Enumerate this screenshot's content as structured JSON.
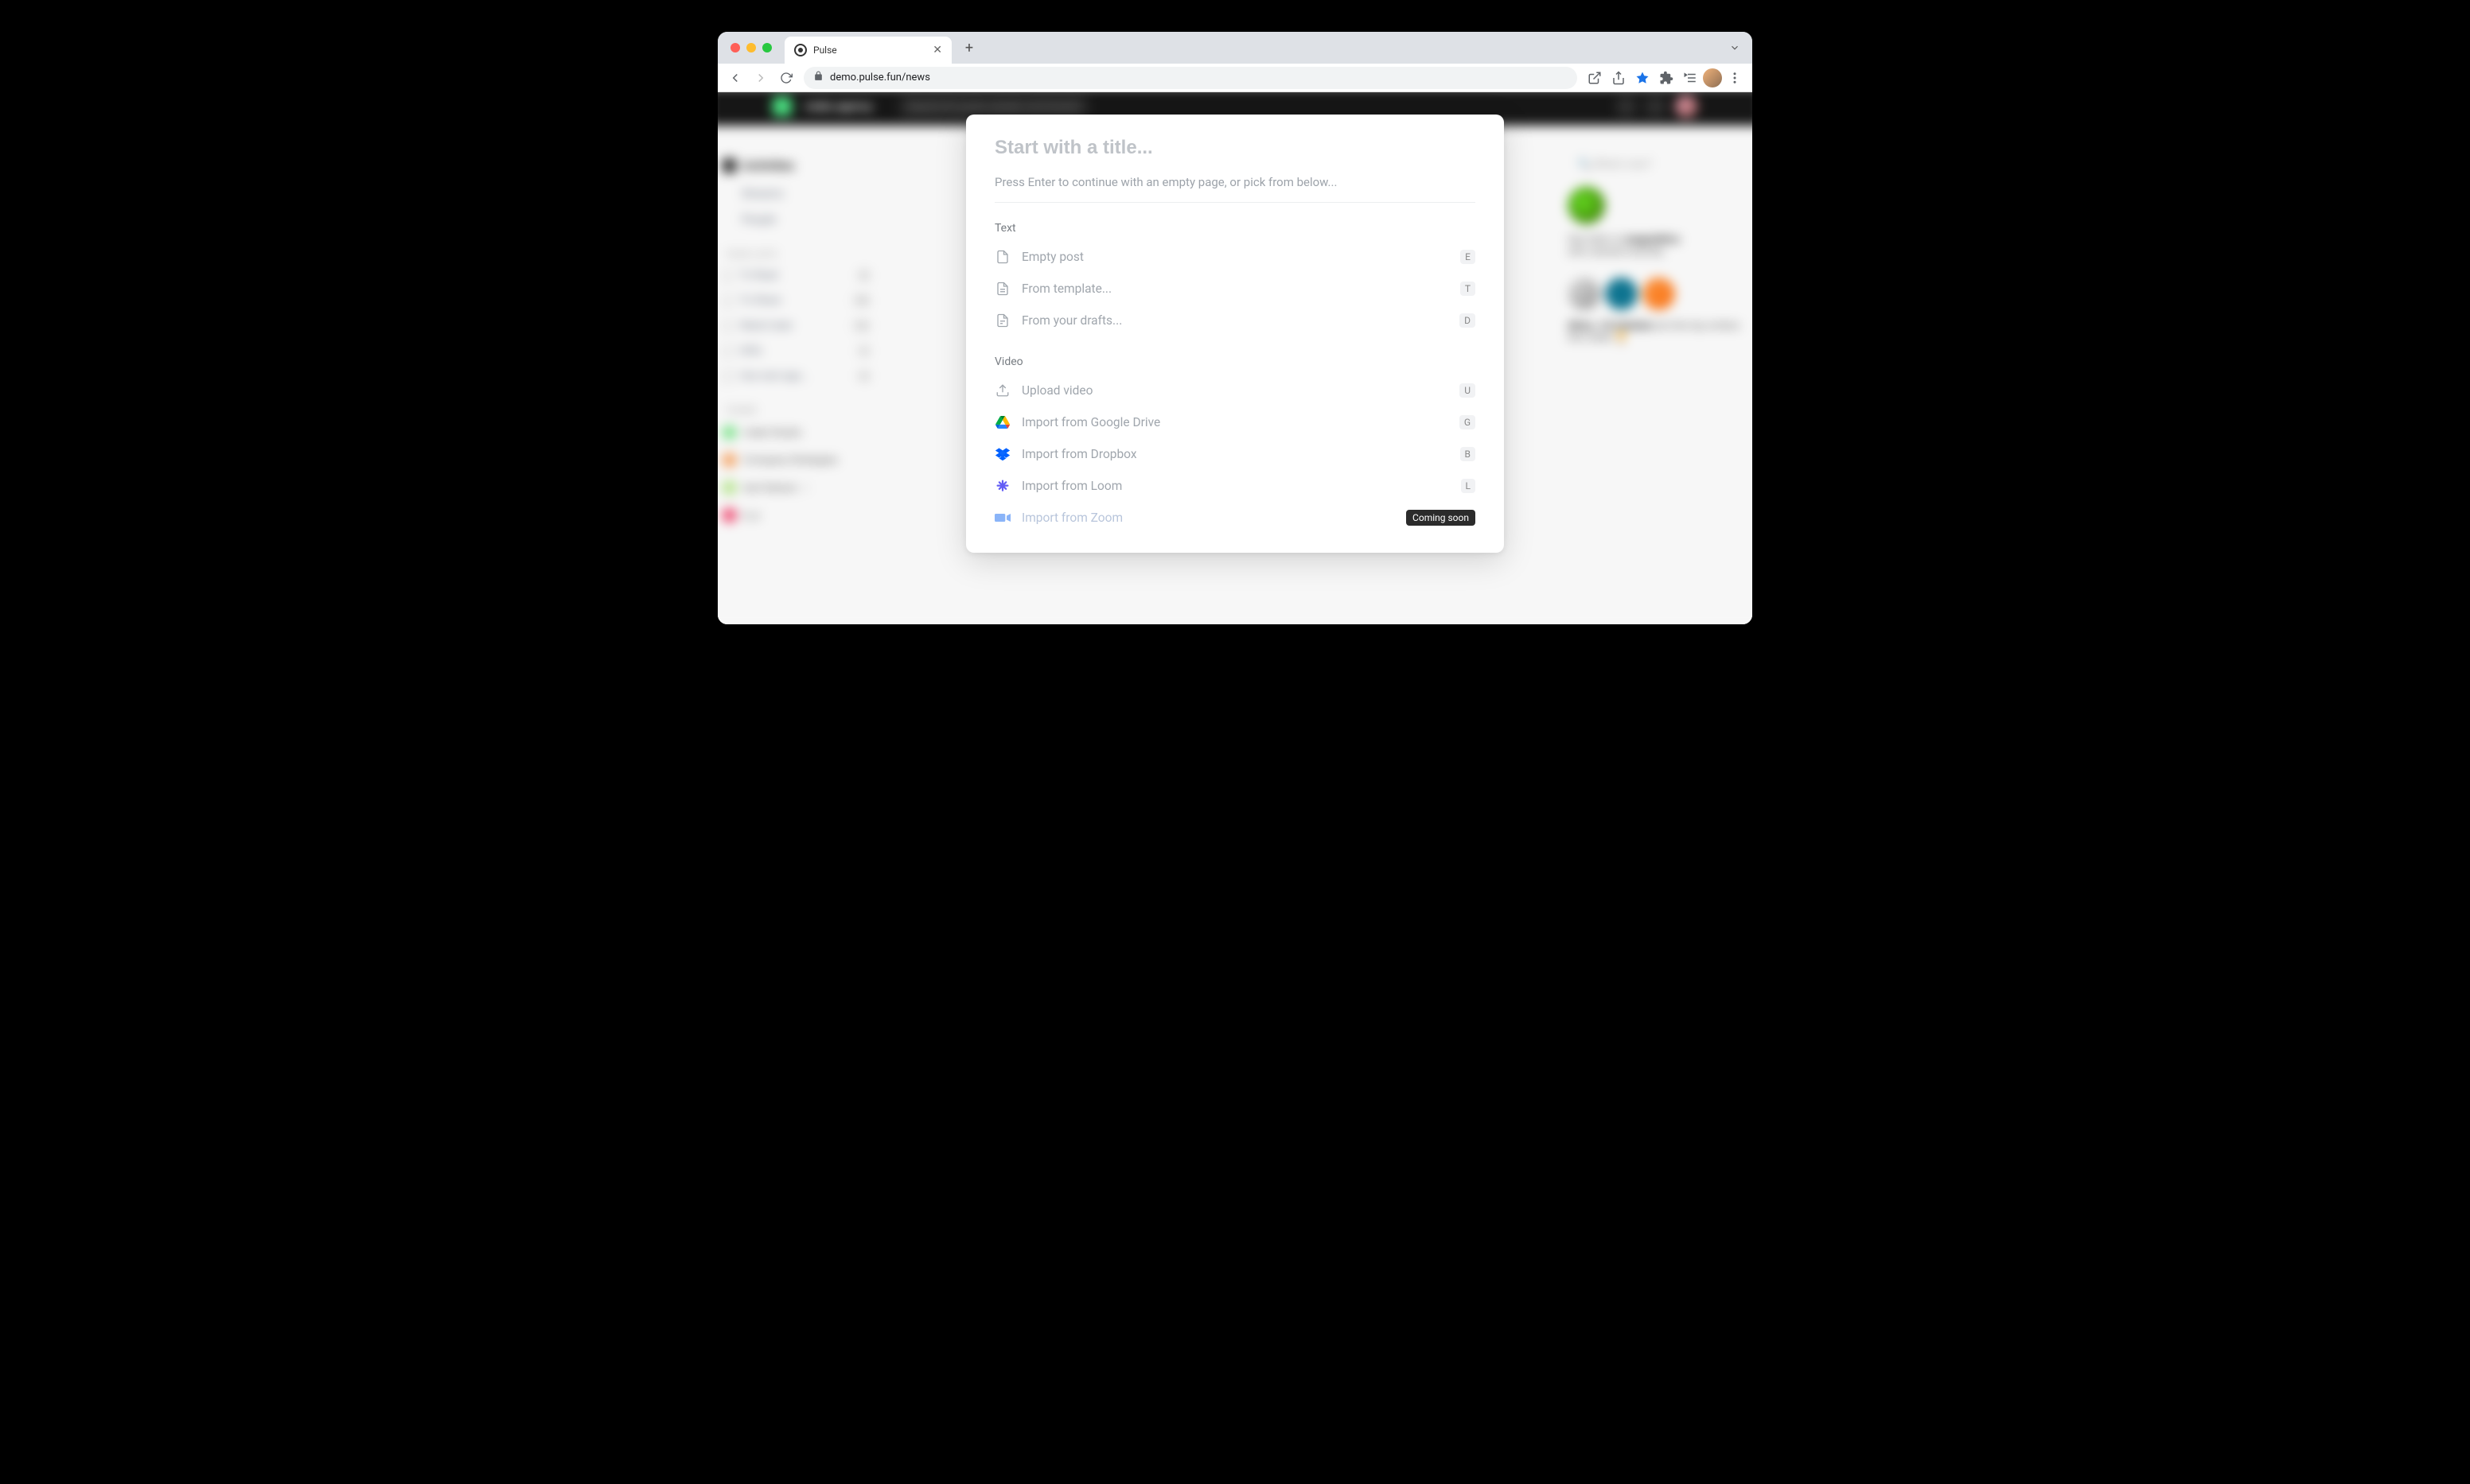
{
  "browser": {
    "tab_title": "Pulse",
    "url_display": "demo.pulse.fun/news"
  },
  "modal": {
    "title_placeholder": "Start with a title...",
    "hint": "Press Enter to continue with an empty page, or pick from below...",
    "sections": {
      "text": {
        "label": "Text",
        "options": {
          "empty_post": {
            "label": "Empty post",
            "shortcut": "E"
          },
          "from_template": {
            "label": "From template...",
            "shortcut": "T"
          },
          "from_drafts": {
            "label": "From your drafts...",
            "shortcut": "D"
          }
        }
      },
      "video": {
        "label": "Video",
        "options": {
          "upload": {
            "label": "Upload video",
            "shortcut": "U"
          },
          "gdrive": {
            "label": "Import from Google Drive",
            "shortcut": "G"
          },
          "dropbox": {
            "label": "Import from Dropbox",
            "shortcut": "B"
          },
          "loom": {
            "label": "Import from Loom",
            "shortcut": "L"
          },
          "zoom": {
            "label": "Import from Zoom",
            "badge": "Coming soon"
          }
        }
      }
    }
  }
}
